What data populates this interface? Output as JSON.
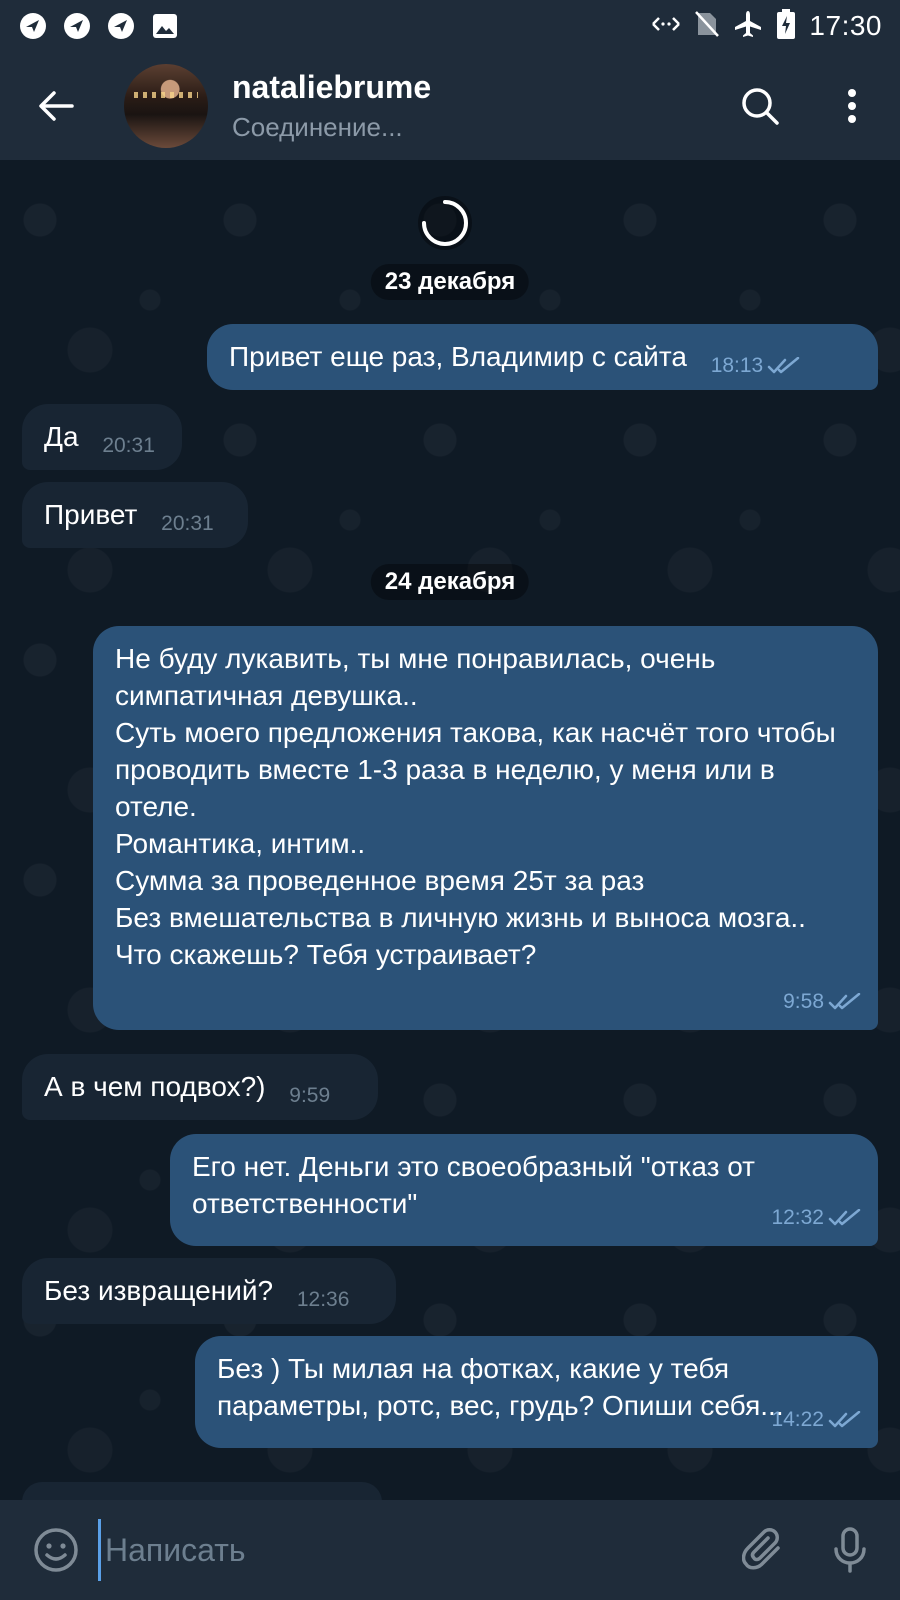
{
  "status_bar": {
    "time": "17:30",
    "left_icons": [
      "app-notification-icon",
      "app-notification-icon",
      "app-notification-icon",
      "image-notification-icon"
    ],
    "right_icons": [
      "data-transfer-icon",
      "no-sim-icon",
      "airplane-mode-icon",
      "battery-charging-icon"
    ]
  },
  "header": {
    "name": "nataliebrume",
    "status": "Соединение..."
  },
  "chat": {
    "date_1": "23 декабря",
    "date_2": "24 декабря",
    "messages": [
      {
        "direction": "out",
        "text": "Привет еще раз, Владимир с сайта",
        "time": "18:13",
        "read": true
      },
      {
        "direction": "in",
        "text": "Да",
        "time": "20:31"
      },
      {
        "direction": "in",
        "text": "Привет",
        "time": "20:31"
      },
      {
        "direction": "out",
        "text": "Не буду лукавить, ты мне понравилась, очень симпатичная девушка..\nСуть моего предложения такова, как насчёт того чтобы проводить вместе 1-3 раза в неделю, у меня или в отеле.\nРомантика, интим..\nСумма за проведенное время 25т за раз\nБез вмешательства в личную жизнь и выноса мозга..\nЧто скажешь? Тебя устраивает?",
        "time": "9:58",
        "read": true
      },
      {
        "direction": "in",
        "text": "А в чем подвох?)",
        "time": "9:59"
      },
      {
        "direction": "out",
        "text": "Его нет. Деньги это своеобразный \"отказ от ответственности\"",
        "time": "12:32",
        "read": true
      },
      {
        "direction": "in",
        "text": "Без извращений?",
        "time": "12:36"
      },
      {
        "direction": "out",
        "text": "Без ) Ты милая на фотках, какие у тебя параметры, ротс, вес, грудь? Опиши себя...",
        "time": "14:22",
        "read": true
      }
    ]
  },
  "input": {
    "placeholder": "Написать"
  },
  "colors": {
    "outgoing_bubble": "#2b5278",
    "incoming_bubble": "#182533",
    "bar_background": "#1f2c3a",
    "accent": "#5aa0e8"
  }
}
